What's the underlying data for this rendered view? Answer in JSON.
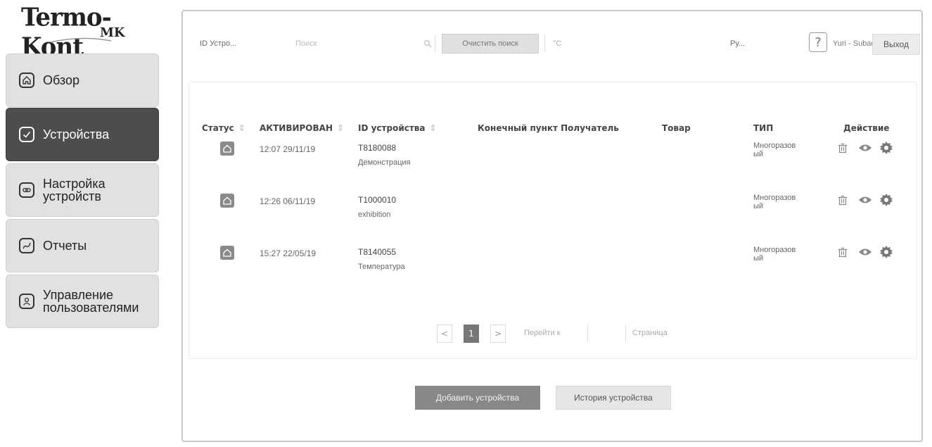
{
  "logo": {
    "brand": "Termo-Kont",
    "sub": "MK"
  },
  "sidebar": {
    "items": [
      {
        "label": "Обзор",
        "icon": "home-icon"
      },
      {
        "label": "Устройства",
        "icon": "check-icon"
      },
      {
        "label": "Настройка\nустройств",
        "icon": "link-icon"
      },
      {
        "label": "Отчеты",
        "icon": "chart-line-icon"
      },
      {
        "label": "Управление\nпользователями",
        "icon": "user-icon"
      }
    ],
    "active_index": 1
  },
  "topbar": {
    "device_id_label": "ID Устро...",
    "search_placeholder": "Поиск",
    "clear_search": "Очистить поиск",
    "unit": "°C",
    "language": "Ру...",
    "help": "?",
    "user": "Yuri - Subac",
    "exit": "Выход"
  },
  "table": {
    "headers": {
      "status": "Статус",
      "activated": "АКТИВИРОВАН",
      "device_id": "ID устройства",
      "destination": "Конечный пункт Получатель",
      "goods": "Товар",
      "type": "ТИП",
      "action": "Действие"
    },
    "rows": [
      {
        "activated": "12:07 29/11/19",
        "device_id": "T8180088",
        "name": "Демонстрация",
        "type": "Многоразовый"
      },
      {
        "activated": "12:26 06/11/19",
        "device_id": "T1000010",
        "name": "exhibition",
        "type": "Многоразовый"
      },
      {
        "activated": "15:27 22/05/19",
        "device_id": "T8140055",
        "name": "Температура",
        "type": "Многоразовый"
      }
    ]
  },
  "pager": {
    "prev": "<",
    "current": "1",
    "next": ">",
    "goto": "Перейти к",
    "page": "Страница"
  },
  "footer": {
    "add_devices": "Добавить устройства",
    "device_history": "История устройства"
  },
  "colors": {
    "active_sidebar": "#4d4d4d",
    "sidebar": "#e1e1e1",
    "primary_button": "#888888"
  }
}
